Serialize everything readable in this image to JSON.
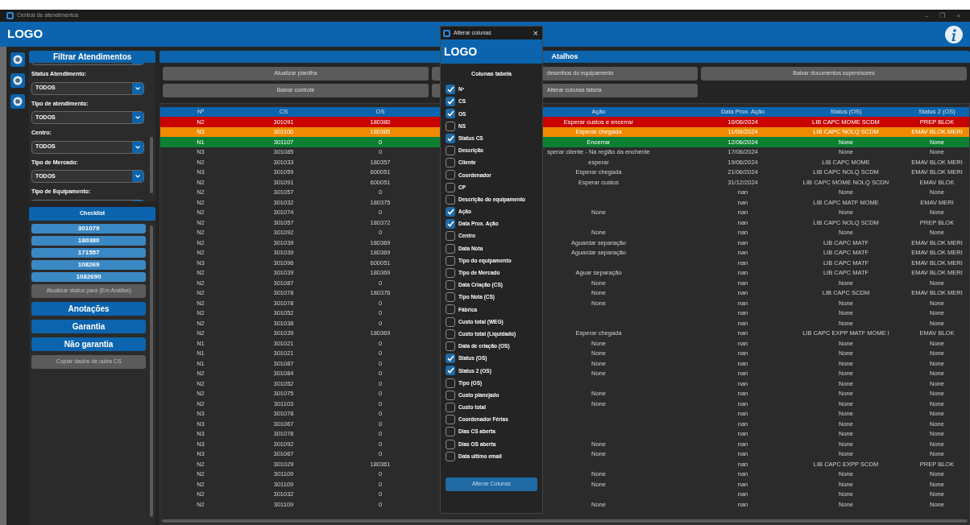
{
  "window": {
    "title": "Central de atendimentos",
    "controls": [
      "–",
      "❐",
      "×"
    ]
  },
  "header": {
    "logo": "LOGO"
  },
  "filters": {
    "title": "Filtrar Atendimentos",
    "fields": [
      {
        "label": "Status Atendimento:",
        "value": "TODOS"
      },
      {
        "label": "Tipo de atendimento:",
        "value": "TODOS"
      },
      {
        "label": "Centro:",
        "value": "TODOS"
      },
      {
        "label": "Tipo de Mercado:",
        "value": "TODOS"
      },
      {
        "label": "Tipo de Equipamento:"
      }
    ]
  },
  "checklist": {
    "title": "Checklist",
    "items": [
      "301079",
      "180380",
      "171557",
      "108269",
      "1082690"
    ]
  },
  "actions": [
    {
      "label": "Atualizar status para (Em Análise)",
      "kind": "secondary"
    },
    {
      "label": "Anotações",
      "kind": "primary"
    },
    {
      "label": "Garantia",
      "kind": "primary"
    },
    {
      "label": "Não garantia",
      "kind": "primary"
    },
    {
      "label": "Copiar dados de outra CS",
      "kind": "secondary"
    }
  ],
  "shortcuts": {
    "title": "Atalhos",
    "rows": [
      [
        "Atualizar planilha",
        "desenhos do equipamento",
        "Baixar documentos supervisores"
      ],
      [
        "Baixar controle",
        "Alterar colunas tabela"
      ]
    ]
  },
  "table": {
    "columns": [
      "Nº",
      "CS",
      "OS",
      "Ação",
      "Data Prox. Ação",
      "Status (OS)",
      "Status 2 (OS)"
    ],
    "rows": [
      {
        "color": "#c80000",
        "cells": [
          "N2",
          "301091",
          "180380",
          "Esperar custos e encerrar",
          "10/06/2024",
          "LIB  CAPC MOME SCDM",
          "PREP BLOK"
        ]
      },
      {
        "color": "#f08a00",
        "cells": [
          "N3",
          "301100",
          "180385",
          "Esperar chegada",
          "11/06/2024",
          "LIB  CAPC NOLQ SCDM",
          "EMAV BLOK MERI"
        ]
      },
      {
        "color": "#0c8030",
        "cells": [
          "N1",
          "301107",
          "0",
          "Encerrar",
          "12/06/2024",
          "None",
          "None"
        ]
      },
      {
        "cells": [
          "N3",
          "301085",
          "0",
          "sperar cliente - Na região da enchente",
          "17/06/2024",
          "None",
          "None"
        ]
      },
      {
        "cells": [
          "N2",
          "301033",
          "180357",
          "esperar",
          "19/06/2024",
          "LIB  CAPC MOME",
          "EMAV BLOK MERI"
        ]
      },
      {
        "cells": [
          "N3",
          "301059",
          "600051",
          "Esperar chegada",
          "21/06/2024",
          "LIB  CAPC NOLQ SCDM",
          "EMAV BLOK MERI"
        ]
      },
      {
        "cells": [
          "N2",
          "301091",
          "600051",
          "Esperar custos",
          "31/12/2024",
          "LIB  CAPC MOME NOLQ SCDN",
          "EMAV BLOK"
        ]
      },
      {
        "cells": [
          "N2",
          "301057",
          "0",
          null,
          "nan",
          "None",
          "None"
        ]
      },
      {
        "cells": [
          "N2",
          "301032",
          "180375",
          null,
          "nan",
          "LIB  CAPC MATF MOME",
          "EMAV MERI"
        ]
      },
      {
        "cells": [
          "N2",
          "301074",
          "0",
          "None",
          "nan",
          "None",
          "None"
        ]
      },
      {
        "cells": [
          "N2",
          "301057",
          "180372",
          null,
          "nan",
          "LIB  CAPC NOLQ SCDM",
          "PREP BLOK"
        ]
      },
      {
        "cells": [
          "N2",
          "301092",
          "0",
          "None",
          "nan",
          "None",
          "None"
        ]
      },
      {
        "cells": [
          "N2",
          "301039",
          "180369",
          "Aguardar separação",
          "nan",
          "LIB  CAPC MATF",
          "EMAV BLOK MERI"
        ]
      },
      {
        "cells": [
          "N2",
          "301039",
          "180369",
          "Aguardar separação",
          "nan",
          "LIB  CAPC MATF",
          "EMAV BLOK MERI"
        ]
      },
      {
        "cells": [
          "N3",
          "301096",
          "600051",
          null,
          "nan",
          "LIB  CAPC MATF",
          "EMAV BLOK MERI"
        ]
      },
      {
        "cells": [
          "N2",
          "301039",
          "180369",
          "Aguar separação",
          "nan",
          "LIB  CAPC MATF",
          "EMAV BLOK MERI"
        ]
      },
      {
        "cells": [
          "N2",
          "301087",
          "0",
          "None",
          "nan",
          "None",
          "None"
        ]
      },
      {
        "cells": [
          "N2",
          "301078",
          "180376",
          "None",
          "nan",
          "LIB  CAPC SCDM",
          "EMAV BLOK MERI"
        ]
      },
      {
        "cells": [
          "N2",
          "301078",
          "0",
          "None",
          "nan",
          "None",
          "None"
        ]
      },
      {
        "cells": [
          "N2",
          "301052",
          "0",
          null,
          "nan",
          "None",
          "None"
        ]
      },
      {
        "cells": [
          "N2",
          "301038",
          "0",
          null,
          "nan",
          "None",
          "None"
        ]
      },
      {
        "cells": [
          "N2",
          "301039",
          "180369",
          "Esperar chegada",
          "nan",
          "LIB  CAPC EXPP MATF MOME I",
          "EMAV BLOK"
        ]
      },
      {
        "cells": [
          "N1",
          "301021",
          "0",
          "None",
          "nan",
          "None",
          "None"
        ]
      },
      {
        "cells": [
          "N1",
          "301021",
          "0",
          "None",
          "nan",
          "None",
          "None"
        ]
      },
      {
        "cells": [
          "N1",
          "301087",
          "0",
          "None",
          "nan",
          "None",
          "None"
        ]
      },
      {
        "cells": [
          "N2",
          "301084",
          "0",
          "None",
          "nan",
          "None",
          "None"
        ]
      },
      {
        "cells": [
          "N2",
          "301052",
          "0",
          null,
          "nan",
          "None",
          "None"
        ]
      },
      {
        "cells": [
          "N2",
          "301075",
          "0",
          "None",
          "nan",
          "None",
          "None"
        ]
      },
      {
        "cells": [
          "N2",
          "301103",
          "0",
          "None",
          "nan",
          "None",
          "None"
        ]
      },
      {
        "cells": [
          "N3",
          "301078",
          "0",
          null,
          "nan",
          "None",
          "None"
        ]
      },
      {
        "cells": [
          "N3",
          "301067",
          "0",
          null,
          "nan",
          "None",
          "None"
        ]
      },
      {
        "cells": [
          "N3",
          "301078",
          "0",
          null,
          "nan",
          "None",
          "None"
        ]
      },
      {
        "cells": [
          "N3",
          "301092",
          "0",
          "None",
          "nan",
          "None",
          "None"
        ]
      },
      {
        "cells": [
          "N3",
          "301067",
          "0",
          "None",
          "nan",
          "None",
          "None"
        ]
      },
      {
        "cells": [
          "N2",
          "301029",
          "180361",
          null,
          "nan",
          "LIB  CAPC EXPP SCDM",
          "PREP BLOK"
        ]
      },
      {
        "cells": [
          "N2",
          "301109",
          "0",
          "None",
          "nan",
          "None",
          "None"
        ]
      },
      {
        "cells": [
          "N2",
          "301109",
          "0",
          "None",
          "nan",
          "None",
          "None"
        ]
      },
      {
        "cells": [
          "N2",
          "301032",
          "0",
          null,
          "nan",
          "None",
          "None"
        ]
      },
      {
        "cells": [
          "N2",
          "301109",
          "0",
          "None",
          "nan",
          "None",
          "None"
        ]
      }
    ]
  },
  "dialog": {
    "title": "Alterar colunas",
    "close": "×",
    "logo": "LOGO",
    "heading": "Colunas tabela",
    "button": "Alterar Colunas",
    "options": [
      {
        "label": "Nº",
        "checked": true
      },
      {
        "label": "CS",
        "checked": true
      },
      {
        "label": "OS",
        "checked": true
      },
      {
        "label": "NS",
        "checked": false
      },
      {
        "label": "Status CS",
        "checked": true
      },
      {
        "label": "Descrição",
        "checked": false
      },
      {
        "label": "Cliente",
        "checked": false
      },
      {
        "label": "Coordenador",
        "checked": false
      },
      {
        "label": "CP",
        "checked": false
      },
      {
        "label": "Descrição do equipamento",
        "checked": false
      },
      {
        "label": "Ação",
        "checked": true
      },
      {
        "label": "Data Prox. Ação",
        "checked": true
      },
      {
        "label": "Centro",
        "checked": false
      },
      {
        "label": "Data Nota",
        "checked": false
      },
      {
        "label": "Tipo do equipamento",
        "checked": false
      },
      {
        "label": "Tipo de Mercado",
        "checked": false
      },
      {
        "label": "Data Criação (CS)",
        "checked": false
      },
      {
        "label": "Tipo Nota (CS)",
        "checked": false
      },
      {
        "label": "Fábrica",
        "checked": false
      },
      {
        "label": "Custo total (WEG)",
        "checked": false
      },
      {
        "label": "Custo total (Liquidado)",
        "checked": false
      },
      {
        "label": "Data de criação (OS)",
        "checked": false
      },
      {
        "label": "Status (OS)",
        "checked": true
      },
      {
        "label": "Status 2 (OS)",
        "checked": true
      },
      {
        "label": "Tipo (OS)",
        "checked": false
      },
      {
        "label": "Custo planejado",
        "checked": false
      },
      {
        "label": "Custo total",
        "checked": false
      },
      {
        "label": "Coordenador Férias",
        "checked": false
      },
      {
        "label": "Dias CS aberta",
        "checked": false
      },
      {
        "label": "Dias OS aberta",
        "checked": false
      },
      {
        "label": "Data ultimo email",
        "checked": false
      }
    ]
  }
}
